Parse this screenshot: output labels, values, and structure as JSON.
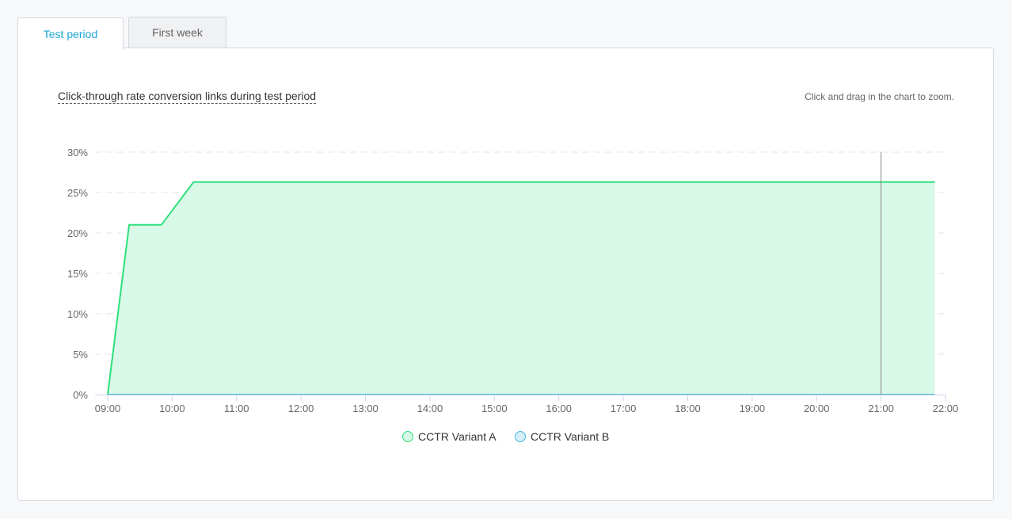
{
  "tabs": [
    {
      "label": "Test period",
      "active": true
    },
    {
      "label": "First week",
      "active": false
    }
  ],
  "hint": "Click and drag in the chart to zoom.",
  "colors": {
    "variant_a": "#2ee07b",
    "variant_a_fill": "#d8f8e8",
    "variant_b": "#45b7dd",
    "variant_b_fill": "#d6eef8",
    "grid": "#e6e6e6",
    "crosshair": "#888888",
    "tab_active": "#1aa6d3"
  },
  "chart_data": {
    "type": "area",
    "title": "Click-through rate conversion links during test period",
    "xlabel": "",
    "ylabel": "",
    "ylim": [
      0,
      30
    ],
    "xlim": [
      "09:00",
      "22:00"
    ],
    "y_ticks": [
      "0%",
      "5%",
      "10%",
      "15%",
      "20%",
      "25%",
      "30%"
    ],
    "x_ticks": [
      "09:00",
      "10:00",
      "11:00",
      "12:00",
      "13:00",
      "14:00",
      "15:00",
      "16:00",
      "17:00",
      "18:00",
      "19:00",
      "20:00",
      "21:00",
      "22:00"
    ],
    "grid": true,
    "legend_position": "bottom",
    "crosshair_at": "21:00",
    "series": [
      {
        "name": "CCTR Variant A",
        "points": [
          {
            "x": "09:00",
            "y": 0
          },
          {
            "x": "09:20",
            "y": 21
          },
          {
            "x": "09:50",
            "y": 21
          },
          {
            "x": "10:20",
            "y": 26.3
          },
          {
            "x": "21:50",
            "y": 26.3
          }
        ]
      },
      {
        "name": "CCTR Variant B",
        "points": [
          {
            "x": "09:00",
            "y": 0
          },
          {
            "x": "21:50",
            "y": 0
          }
        ]
      }
    ]
  }
}
